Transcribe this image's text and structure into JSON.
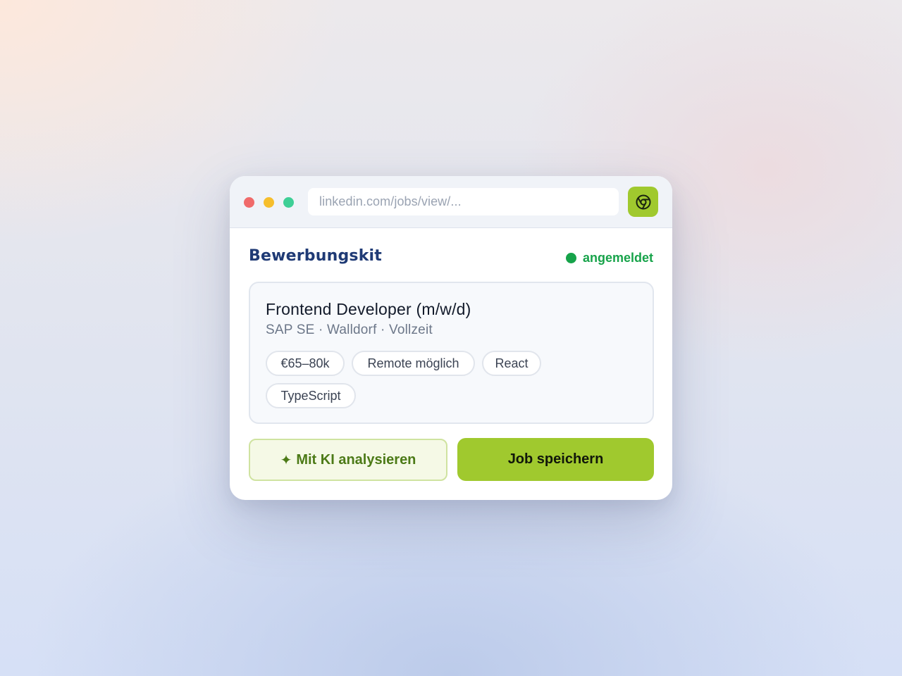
{
  "window": {
    "url": "linkedin.com/jobs/view/...",
    "extension_icon": "chrome-icon"
  },
  "header": {
    "brand": "Bewerbungskit",
    "status_label": "angemeldet",
    "status_color": "#16a34a"
  },
  "job": {
    "title": "Frontend Developer (m/w/d)",
    "meta": "SAP SE · Walldorf · Vollzeit",
    "tags": [
      "€65–80k",
      "Remote möglich",
      "React",
      "TypeScript"
    ]
  },
  "actions": {
    "analyze_icon": "sparkle-icon",
    "analyze_glyph": "✦",
    "analyze_label": "Mit KI analysieren",
    "save_label": "Job speichern"
  },
  "colors": {
    "accent": "#a0c92e",
    "brand_text": "#1f3a75"
  }
}
